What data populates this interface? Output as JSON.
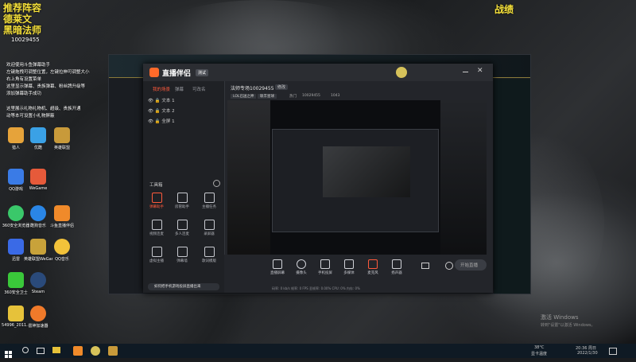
{
  "overlay": {
    "title_left_1": "推荐阵容",
    "title_left_2": "德莱文",
    "title_left_3": "黑暗法师",
    "title_right": "战绩",
    "notes": [
      "欢迎使用斗鱼弹幕助手",
      "左键拖拽可调整位置，左键拉伸可调整大小",
      "右上角有设置菜单",
      "这里显示弹幕、贵族弹幕、粉丝牌升级等",
      "添加弹幕助手成功",
      "这里展示礼物礼物机、超级、贵族开通",
      "动等本可设置小礼物屏蔽"
    ]
  },
  "desktop": {
    "room_id": "10029455",
    "icons": [
      {
        "label": "猎人",
        "color": "#e6a33a"
      },
      {
        "label": "优酷",
        "color": "#3aa1e6"
      },
      {
        "label": "英雄联盟",
        "color": "#c89a3a"
      },
      {
        "label": "QQ游戏",
        "color": "#3a7be6"
      },
      {
        "label": "WeGame",
        "color": "#e65a3a"
      },
      {
        "label": "360安全浏览器",
        "color": "#3ac86a"
      },
      {
        "label": "酷狗音乐",
        "color": "#2a86e6"
      },
      {
        "label": "斗鱼直播伴侣",
        "color": "#f08a2a"
      },
      {
        "label": "迅雷",
        "color": "#3a6ae6"
      },
      {
        "label": "英雄联盟WeGame版",
        "color": "#c8a23a"
      },
      {
        "label": "QQ音乐",
        "color": "#f2c23a"
      },
      {
        "label": "360安全卫士",
        "color": "#3ac83a"
      },
      {
        "label": "Steam",
        "color": "#2a4a7a"
      },
      {
        "label": "54996_2011...",
        "color": "#e6c23a"
      },
      {
        "label": "雷神加速器",
        "color": "#f07a2a"
      }
    ]
  },
  "app": {
    "logo": "直播伴侣",
    "badge": "测试",
    "room_title": "法师专场10029455",
    "edit": "修改",
    "category": "LOL已送之神",
    "tag": "联丰星球",
    "online_label": "热门",
    "online_value": "10029455",
    "fans": "1043",
    "tabs": [
      "我的场景",
      "弹幕",
      "可改名"
    ],
    "scenes": [
      "文本 1",
      "文本 2",
      "全屏 1"
    ],
    "toolbox_title": "工具箱",
    "tools": [
      {
        "label": "弹幕助手",
        "icon": "chat-icon"
      },
      {
        "label": "房管助手",
        "icon": "user-icon"
      },
      {
        "label": "主播任务",
        "icon": "task-icon"
      },
      {
        "label": "视频连麦",
        "icon": "video-icon"
      },
      {
        "label": "多人连麦",
        "icon": "mic-icon"
      },
      {
        "label": "录屏器",
        "icon": "record-icon"
      },
      {
        "label": "虚拟主播",
        "icon": "avatar-icon"
      },
      {
        "label": "弹幕墙",
        "icon": "wall-icon"
      },
      {
        "label": "歌词模版",
        "icon": "lyric-icon"
      },
      {
        "label": "特效",
        "icon": "effect-icon"
      },
      {
        "label": "红包",
        "icon": "redpacket-icon"
      },
      {
        "label": "更多",
        "icon": "more-icon"
      }
    ],
    "banner": "如何把手机游戏投屏直播出来",
    "bottom": [
      {
        "label": "直播屏幕",
        "icon": "screen-icon"
      },
      {
        "label": "摄像头",
        "icon": "camera-icon"
      },
      {
        "label": "手机投屏",
        "icon": "phone-icon"
      },
      {
        "label": "多媒体",
        "icon": "media-icon"
      },
      {
        "label": "麦克风",
        "icon": "mic-icon"
      },
      {
        "label": "扬声器",
        "icon": "speaker-icon"
      }
    ],
    "start_button": "开始直播",
    "status": "码率: 0 kb/s   帧率: 0 FPS   丢帧率: 0.00%   CPU: 0%   内存: 0%"
  },
  "taskbar": {
    "temperature": "38°C",
    "weather": "显卡温度",
    "time": "20:36 周日",
    "date": "2022/1/30",
    "windows_watermark_1": "激活 Windows",
    "windows_watermark_2": "转到\"设置\"以激活 Windows。"
  }
}
